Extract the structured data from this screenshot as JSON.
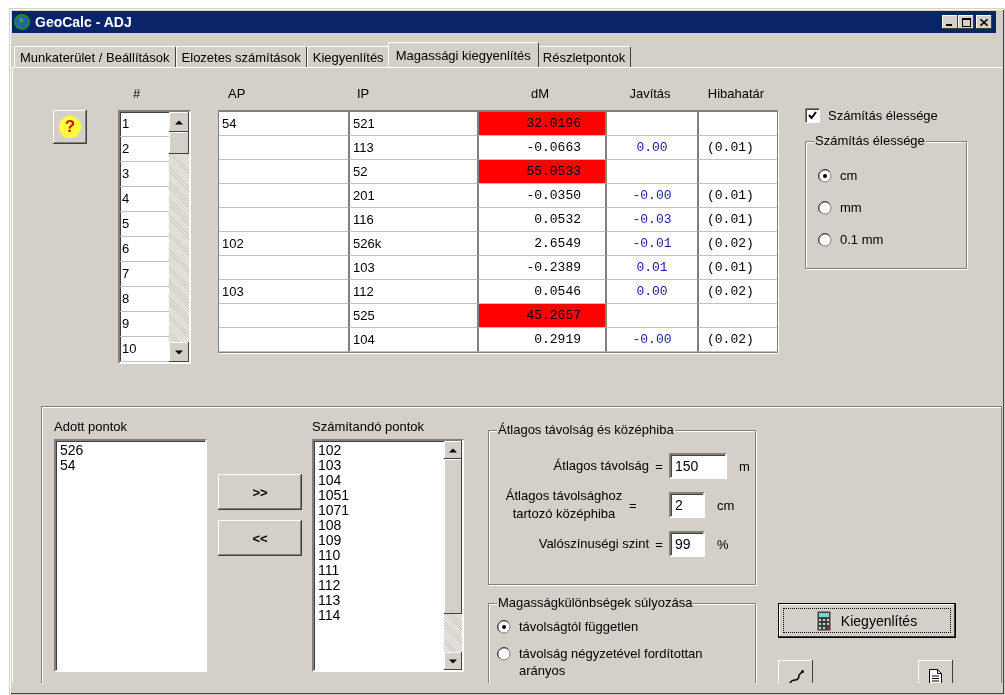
{
  "window": {
    "title": "GeoCalc - ADJ"
  },
  "tabs": [
    {
      "label": "Munkaterület / Beállítások",
      "selected": false
    },
    {
      "label": "Elozetes számítások",
      "selected": false
    },
    {
      "label": "Kiegyenlítés",
      "selected": false
    },
    {
      "label": "Magassági kiegyenlítés",
      "selected": true
    },
    {
      "label": "Részletpontok",
      "selected": false
    }
  ],
  "help_button": {
    "glyph": "?"
  },
  "grid": {
    "columns": [
      "#",
      "AP",
      "IP",
      "dM",
      "Javítás",
      "Hibahatár"
    ],
    "rows": [
      {
        "num": "1",
        "ap": "54",
        "ip": "521",
        "dm": "32.0196",
        "flagged": true
      },
      {
        "num": "2",
        "ip": "113",
        "dm": "-0.0663",
        "flagged": false,
        "javitas": "0.00",
        "hibahatar": "(0.01)"
      },
      {
        "num": "3",
        "ip": "52",
        "dm": "55.0533",
        "flagged": true
      },
      {
        "num": "4",
        "ip": "201",
        "dm": "-0.0350",
        "flagged": false,
        "javitas": "-0.00",
        "hibahatar": "(0.01)"
      },
      {
        "num": "5",
        "ip": "116",
        "dm": "0.0532",
        "flagged": false,
        "javitas": "-0.03",
        "hibahatar": "(0.01)"
      },
      {
        "num": "6",
        "ap": "102",
        "ip": "526k",
        "dm": "2.6549",
        "flagged": false,
        "javitas": "-0.01",
        "hibahatar": "(0.02)"
      },
      {
        "num": "7",
        "ip": "103",
        "dm": "-0.2389",
        "flagged": false,
        "javitas": "0.01",
        "hibahatar": "(0.01)"
      },
      {
        "num": "8",
        "ap": "103",
        "ip": "112",
        "dm": "0.0546",
        "flagged": false,
        "javitas": "0.00",
        "hibahatar": "(0.02)"
      },
      {
        "num": "9",
        "ip": "525",
        "dm": "45.2657",
        "flagged": true
      },
      {
        "num": "10",
        "ip": "104",
        "dm": "0.2919",
        "flagged": false,
        "javitas": "-0.00",
        "hibahatar": "(0.02)"
      }
    ]
  },
  "precision": {
    "checkbox": {
      "label": "Számítás élessége",
      "checked": true
    },
    "group_title": "Számítás élessége",
    "options": [
      {
        "label": "cm",
        "selected": true
      },
      {
        "label": "mm",
        "selected": false
      },
      {
        "label": "0.1 mm",
        "selected": false
      }
    ]
  },
  "given_points": {
    "label": "Adott pontok",
    "items": [
      "526",
      "54"
    ]
  },
  "move_buttons": [
    ">>",
    "<<"
  ],
  "target_points": {
    "label": "Számítandó pontok",
    "items": [
      "102",
      "103",
      "104",
      "1051",
      "1071",
      "108",
      "109",
      "110",
      "111",
      "112",
      "113",
      "114"
    ]
  },
  "average_group": {
    "title": "Átlagos távolság és középhiba",
    "fields": [
      {
        "label": "Átlagos távolság",
        "equals": "=",
        "value": "150",
        "unit": "m"
      },
      {
        "label": "Átlagos távolsághoz tartozó középhiba",
        "equals": "=",
        "value": "2",
        "unit": "cm"
      },
      {
        "label": "Valószínuségi szint",
        "equals": "=",
        "value": "99",
        "unit": "%"
      }
    ]
  },
  "weighting_group": {
    "title": "Magasságkülönbségek súlyozása",
    "options": [
      {
        "label": "távolságtól független",
        "selected": true
      },
      {
        "label": "távolság négyzetével fordítottan arányos",
        "selected": false
      }
    ]
  },
  "action_button": {
    "label": "Kiegyenlítés"
  }
}
